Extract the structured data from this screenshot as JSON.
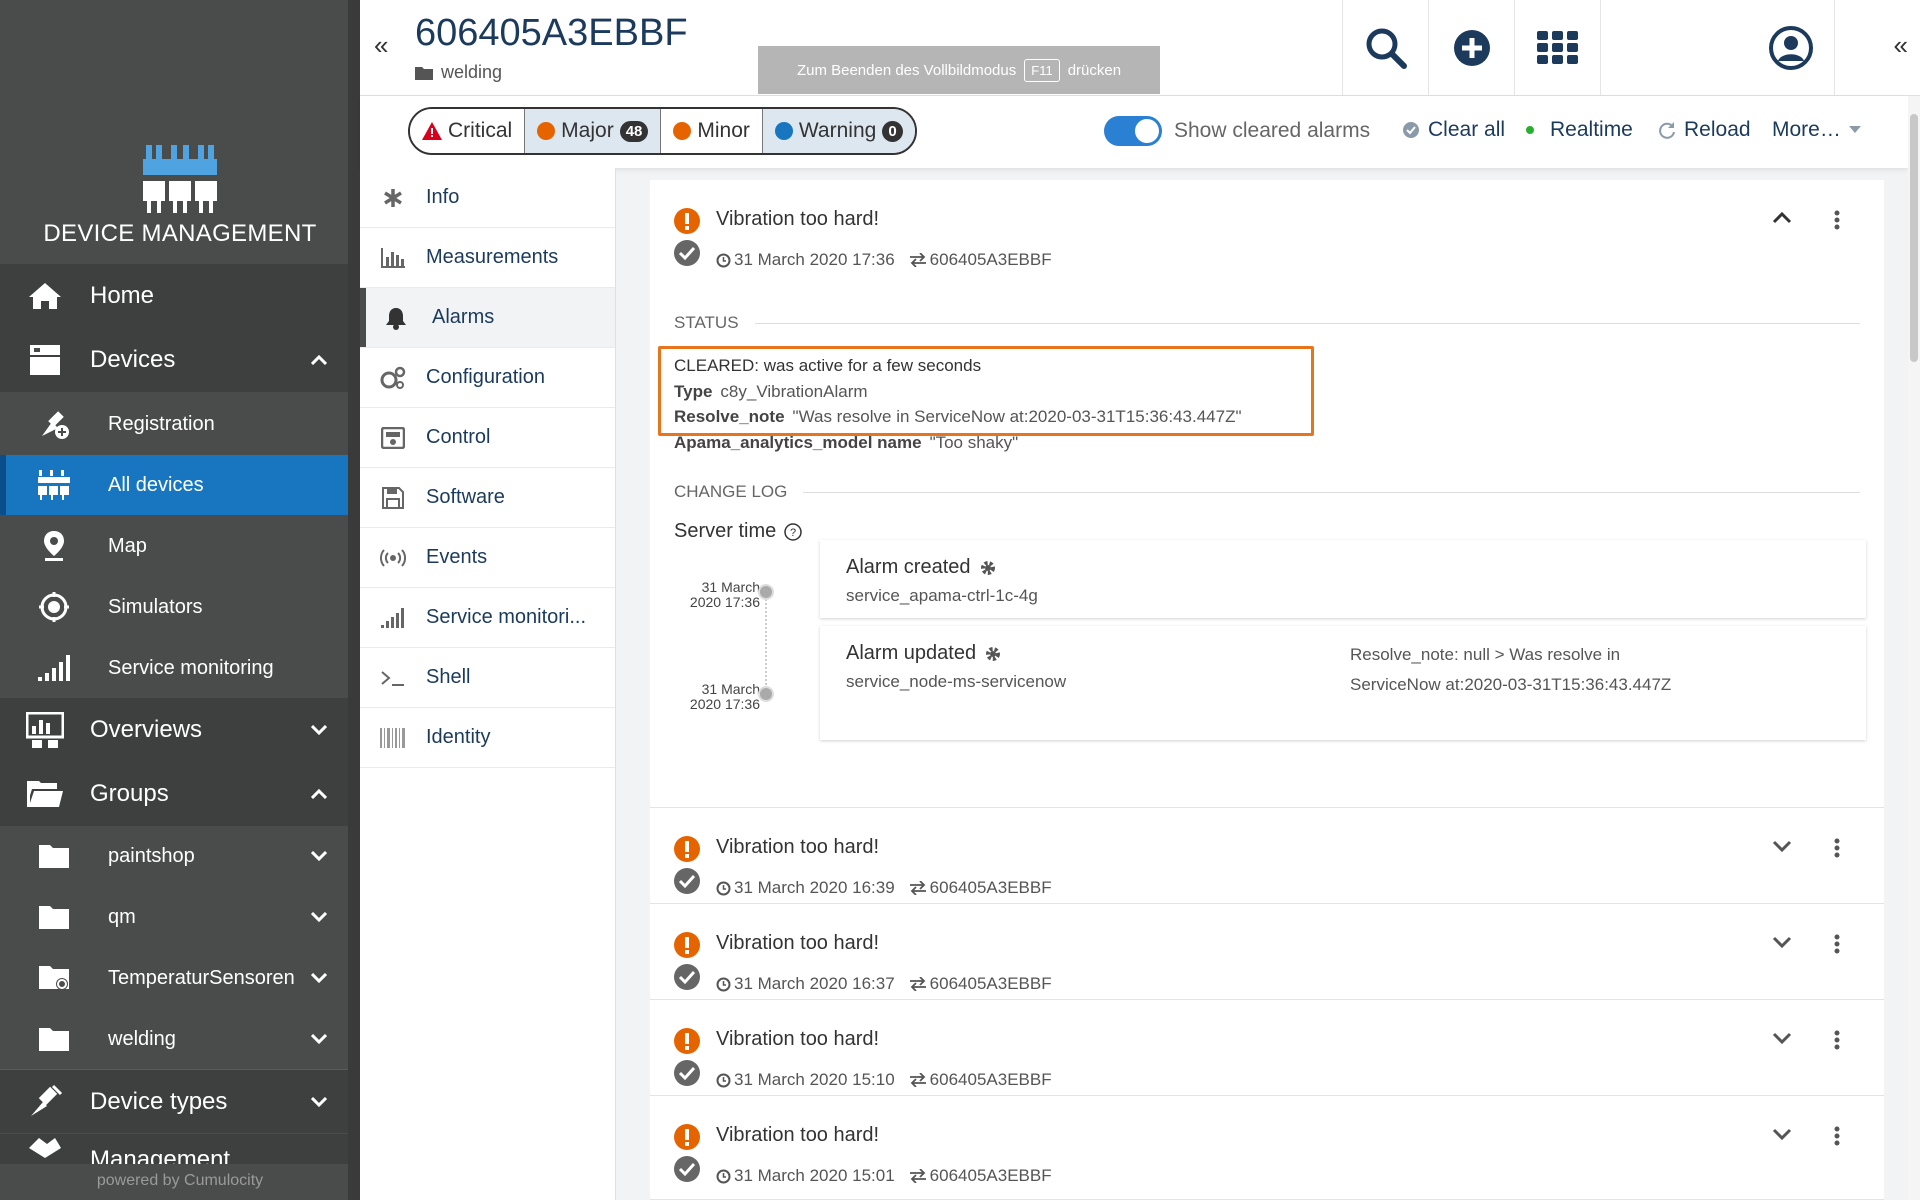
{
  "nav": {
    "app_title": "DEVICE MANAGEMENT",
    "items": [
      {
        "label": "Home"
      },
      {
        "label": "Devices"
      },
      {
        "label": "Registration"
      },
      {
        "label": "All devices"
      },
      {
        "label": "Map"
      },
      {
        "label": "Simulators"
      },
      {
        "label": "Service monitoring"
      },
      {
        "label": "Overviews"
      },
      {
        "label": "Groups"
      },
      {
        "label": "paintshop"
      },
      {
        "label": "qm"
      },
      {
        "label": "TemperaturSensoren"
      },
      {
        "label": "welding"
      },
      {
        "label": "Device types"
      },
      {
        "label": "Management"
      }
    ],
    "powered_by": "powered by Cumulocity"
  },
  "header": {
    "device_name": "606405A3EBBF",
    "folder": "welding",
    "fullscreen_hint_before": "Zum Beenden des Vollbildmodus",
    "fullscreen_key": "F11",
    "fullscreen_hint_after": "drücken"
  },
  "toolbar": {
    "severities": [
      {
        "label": "Critical",
        "color": "#d9001b"
      },
      {
        "label": "Major",
        "count": "48",
        "color": "#e66400"
      },
      {
        "label": "Minor",
        "color": "#e66400"
      },
      {
        "label": "Warning",
        "count": "0",
        "color": "#1776bf"
      }
    ],
    "show_cleared_label": "Show cleared alarms",
    "clear_all": "Clear all",
    "realtime": "Realtime",
    "reload": "Reload",
    "more": "More…"
  },
  "tabs": [
    {
      "label": "Info"
    },
    {
      "label": "Measurements"
    },
    {
      "label": "Alarms"
    },
    {
      "label": "Configuration"
    },
    {
      "label": "Control"
    },
    {
      "label": "Software"
    },
    {
      "label": "Events"
    },
    {
      "label": "Service monitori..."
    },
    {
      "label": "Shell"
    },
    {
      "label": "Identity"
    }
  ],
  "expanded_alarm": {
    "text": "Vibration too hard!",
    "time": "31 March 2020 17:36",
    "source": "606405A3EBBF",
    "status_title": "STATUS",
    "status_line": "CLEARED: was active for a few seconds",
    "type_key": "Type",
    "type_val": "c8y_VibrationAlarm",
    "resolve_key": "Resolve_note",
    "resolve_val": "\"Was resolve in ServiceNow at:2020-03-31T15:36:43.447Z\"",
    "model_key": "Apama_analytics_model name",
    "model_val": "\"Too shaky\"",
    "changelog_title": "CHANGE LOG",
    "server_time": "Server time",
    "log": [
      {
        "date1": "31 March",
        "date2": "2020 17:36",
        "title": "Alarm created",
        "user": "service_apama-ctrl-1c-4g",
        "detail": ""
      },
      {
        "date1": "31 March",
        "date2": "2020 17:36",
        "title": "Alarm updated",
        "user": "service_node-ms-servicenow",
        "detail": "Resolve_note: null > Was resolve in ServiceNow at:2020-03-31T15:36:43.447Z"
      }
    ]
  },
  "alarms": [
    {
      "text": "Vibration too hard!",
      "time": "31 March 2020 16:39",
      "source": "606405A3EBBF"
    },
    {
      "text": "Vibration too hard!",
      "time": "31 March 2020 16:37",
      "source": "606405A3EBBF"
    },
    {
      "text": "Vibration too hard!",
      "time": "31 March 2020 15:10",
      "source": "606405A3EBBF"
    },
    {
      "text": "Vibration too hard!",
      "time": "31 March 2020 15:01",
      "source": "606405A3EBBF"
    }
  ],
  "colors": {
    "accent": "#1776bf",
    "major": "#e66400",
    "critical": "#d9001b",
    "highlight": "#e8741c",
    "nav_bg": "#4a4b4b"
  }
}
